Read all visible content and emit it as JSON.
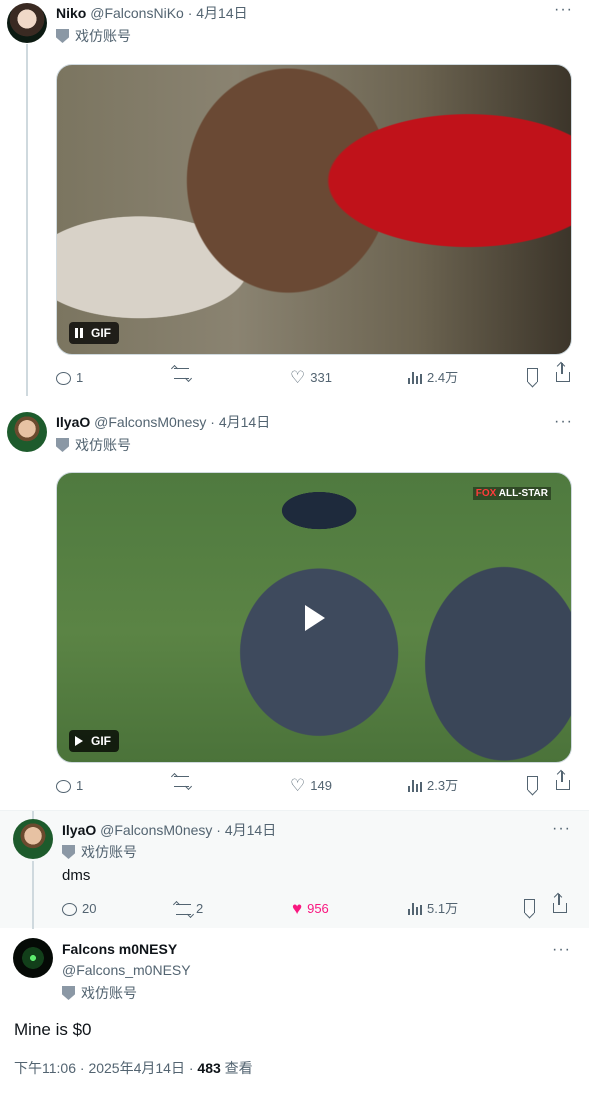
{
  "tweets": [
    {
      "display_name": "Niko",
      "handle": "@FalconsNiKo",
      "date": "4月14日",
      "affiliation": "戏仿账号",
      "media_label": "GIF",
      "media_state": "pause-icon",
      "stats": {
        "replies": "1",
        "retweets": "",
        "likes": "331",
        "views": "2.4万"
      }
    },
    {
      "display_name": "IlyaO",
      "handle": "@FalconsM0nesy",
      "date": "4月14日",
      "affiliation": "戏仿账号",
      "media_label": "GIF",
      "media_state": "play-icon",
      "broadcast_fox": "FOX",
      "broadcast_event": "ALL-STAR",
      "stats": {
        "replies": "1",
        "retweets": "",
        "likes": "149",
        "views": "2.3万"
      }
    },
    {
      "display_name": "IlyaO",
      "handle": "@FalconsM0nesy",
      "date": "4月14日",
      "affiliation": "戏仿账号",
      "text": "dms",
      "stats": {
        "replies": "20",
        "retweets": "2",
        "likes": "956",
        "views": "5.1万"
      },
      "liked": true
    }
  ],
  "main_tweet": {
    "display_name": "Falcons m0NESY",
    "handle": "@Falcons_m0NESY",
    "affiliation": "戏仿账号",
    "text": "Mine is $0",
    "time": "下午11:06",
    "date": "2025年4月14日",
    "views_count": "483",
    "views_label": "查看"
  },
  "separator": "·",
  "colors": {
    "secondary_text": "#536471",
    "like_active": "#f91880",
    "thread_line": "#cfd9de",
    "highlight_bg": "#f7f9f9"
  }
}
